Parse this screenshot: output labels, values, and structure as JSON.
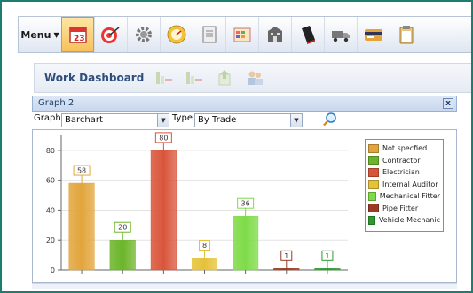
{
  "toolbar": {
    "menu_label": "Menu",
    "tools": [
      {
        "icon": "calendar-icon",
        "active": true
      },
      {
        "icon": "target-icon",
        "active": false
      },
      {
        "icon": "gear-icon",
        "active": false
      },
      {
        "icon": "gauge-icon",
        "active": false
      },
      {
        "icon": "report-icon",
        "active": false
      },
      {
        "icon": "planner-icon",
        "active": false
      },
      {
        "icon": "building-icon",
        "active": false
      },
      {
        "icon": "book-icon",
        "active": false
      },
      {
        "icon": "truck-icon",
        "active": false
      },
      {
        "icon": "card-icon",
        "active": false
      },
      {
        "icon": "clipboard-icon",
        "active": false
      }
    ]
  },
  "dashboard": {
    "title": "Work Dashboard",
    "icons": [
      "chart-add-icon",
      "chart-remove-icon",
      "export-icon",
      "users-icon"
    ]
  },
  "panel": {
    "title": "Graph 2",
    "close_label": "x"
  },
  "controls": {
    "graph_label": "Graph",
    "graph_value": "Barchart",
    "type_label": "Type",
    "type_value": "By Trade"
  },
  "colors": {
    "accent_border": "#1e7d6e"
  },
  "chart_data": {
    "type": "bar",
    "categories": [
      "Not specfied",
      "Contractor",
      "Electrician",
      "Internal Auditor",
      "Mechanical Fitter",
      "Pipe Fitter",
      "Vehicle Mechanic"
    ],
    "values": [
      58,
      20,
      80,
      8,
      36,
      1,
      1
    ],
    "colors": [
      "#e2a53c",
      "#6cb52a",
      "#d9553a",
      "#e5c23a",
      "#7edb47",
      "#9c3a22",
      "#2c9b2a"
    ],
    "ylim": [
      0,
      90
    ],
    "yticks": [
      0,
      20,
      40,
      60,
      80
    ],
    "grid": true,
    "legend_position": "right"
  }
}
